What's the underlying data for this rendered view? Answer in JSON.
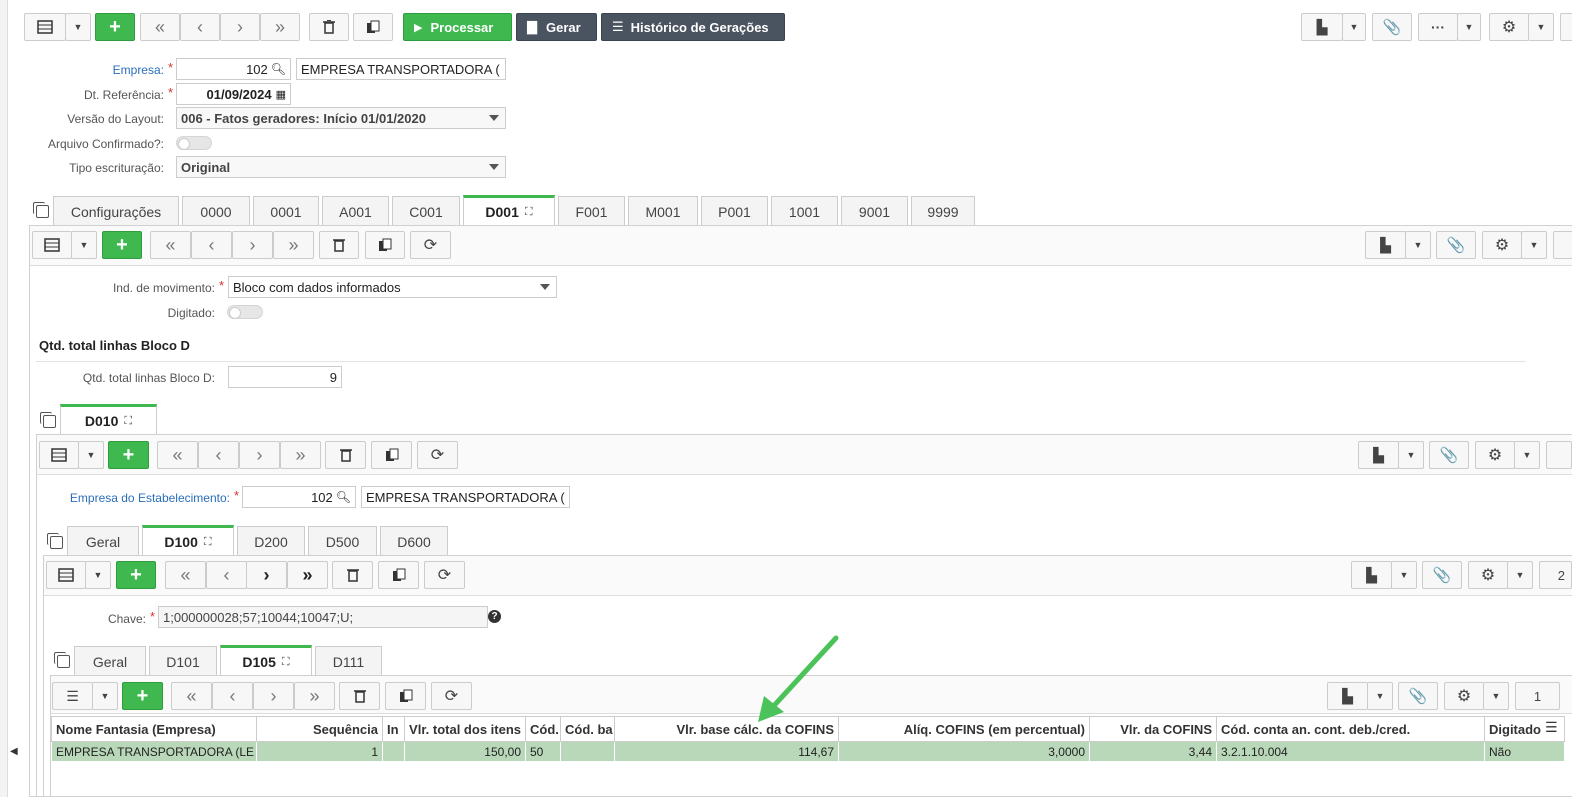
{
  "top_toolbar": {
    "processar_label": "Processar",
    "gerar_label": "Gerar",
    "historico_label": "Histórico de Gerações"
  },
  "header_form": {
    "empresa": {
      "label": "Empresa:",
      "code": "102",
      "name": "EMPRESA TRANSPORTADORA ("
    },
    "dt_referencia": {
      "label": "Dt. Referência:",
      "value": "01/09/2024"
    },
    "versao_layout": {
      "label": "Versão do Layout:",
      "value": "006 - Fatos geradores: Início 01/01/2020"
    },
    "arquivo_confirmado": {
      "label": "Arquivo Confirmado?:"
    },
    "tipo_escrituracao": {
      "label": "Tipo escrituração:",
      "value": "Original"
    }
  },
  "main_tabs": [
    "Configurações",
    "0000",
    "0001",
    "A001",
    "C001",
    "D001",
    "F001",
    "M001",
    "P001",
    "1001",
    "9001",
    "9999"
  ],
  "d001": {
    "ind_movimento": {
      "label": "Ind. de movimento:",
      "value": "Bloco com dados informados"
    },
    "digitado_label": "Digitado:",
    "section_title": "Qtd. total linhas Bloco D",
    "qtd_total": {
      "label": "Qtd. total linhas Bloco D:",
      "value": "9"
    }
  },
  "d010_tabs": [
    "D010"
  ],
  "d010": {
    "empresa_estab": {
      "label": "Empresa do Estabelecimento:",
      "code": "102",
      "name": "EMPRESA TRANSPORTADORA ("
    }
  },
  "sub_tabs": [
    "Geral",
    "D100",
    "D200",
    "D500",
    "D600"
  ],
  "d100": {
    "chave": {
      "label": "Chave:",
      "value": "1;000000028;57;10044;10047;U;"
    },
    "page_number": "2"
  },
  "d100_tabs": [
    "Geral",
    "D101",
    "D105",
    "D111"
  ],
  "d105": {
    "page_number": "1",
    "table": {
      "columns": [
        "Nome Fantasia (Empresa)",
        "Sequência",
        "In",
        "Vlr. total dos itens",
        "Cód.",
        "Cód. ba",
        "Vlr. base cálc. da COFINS",
        "Alíq. COFINS (em percentual)",
        "Vlr. da COFINS",
        "Cód. conta an. cont. deb./cred.",
        "Digitado"
      ],
      "rows": [
        [
          "EMPRESA TRANSPORTADORA (LE",
          "1",
          "",
          "150,00",
          "50",
          "",
          "114,67",
          "3,0000",
          "3,44",
          "3.2.1.10.004",
          "Não"
        ]
      ]
    }
  },
  "colors": {
    "accent_green": "#3fb94f",
    "dark_button": "#4a5360",
    "arrow": "#4cc35a",
    "row_selected": "#b9d8b9"
  }
}
